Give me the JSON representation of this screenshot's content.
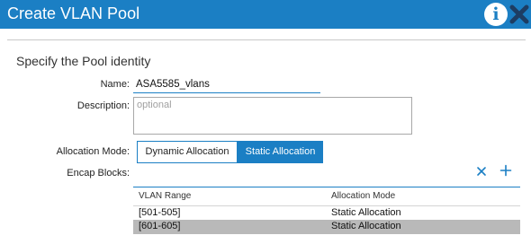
{
  "window": {
    "title": "Create VLAN Pool"
  },
  "icons": {
    "info": "info-icon",
    "close": "close-icon",
    "remove": "remove-icon",
    "add": "add-icon"
  },
  "colors": {
    "accent": "#1b7fc4",
    "selected_row": "#b9b9b9"
  },
  "form": {
    "section_title": "Specify the Pool identity",
    "name_label": "Name:",
    "name_value": "ASA5585_vlans",
    "description_label": "Description:",
    "description_placeholder": "optional",
    "allocation_label": "Allocation Mode:",
    "allocation_options": [
      "Dynamic Allocation",
      "Static Allocation"
    ],
    "allocation_selected": "Static Allocation",
    "encap_label": "Encap Blocks:"
  },
  "encap_table": {
    "headers": [
      "VLAN Range",
      "Allocation Mode"
    ],
    "rows": [
      {
        "range": "[501-505]",
        "mode": "Static Allocation",
        "selected": false
      },
      {
        "range": "[601-605]",
        "mode": "Static Allocation",
        "selected": true
      }
    ]
  }
}
